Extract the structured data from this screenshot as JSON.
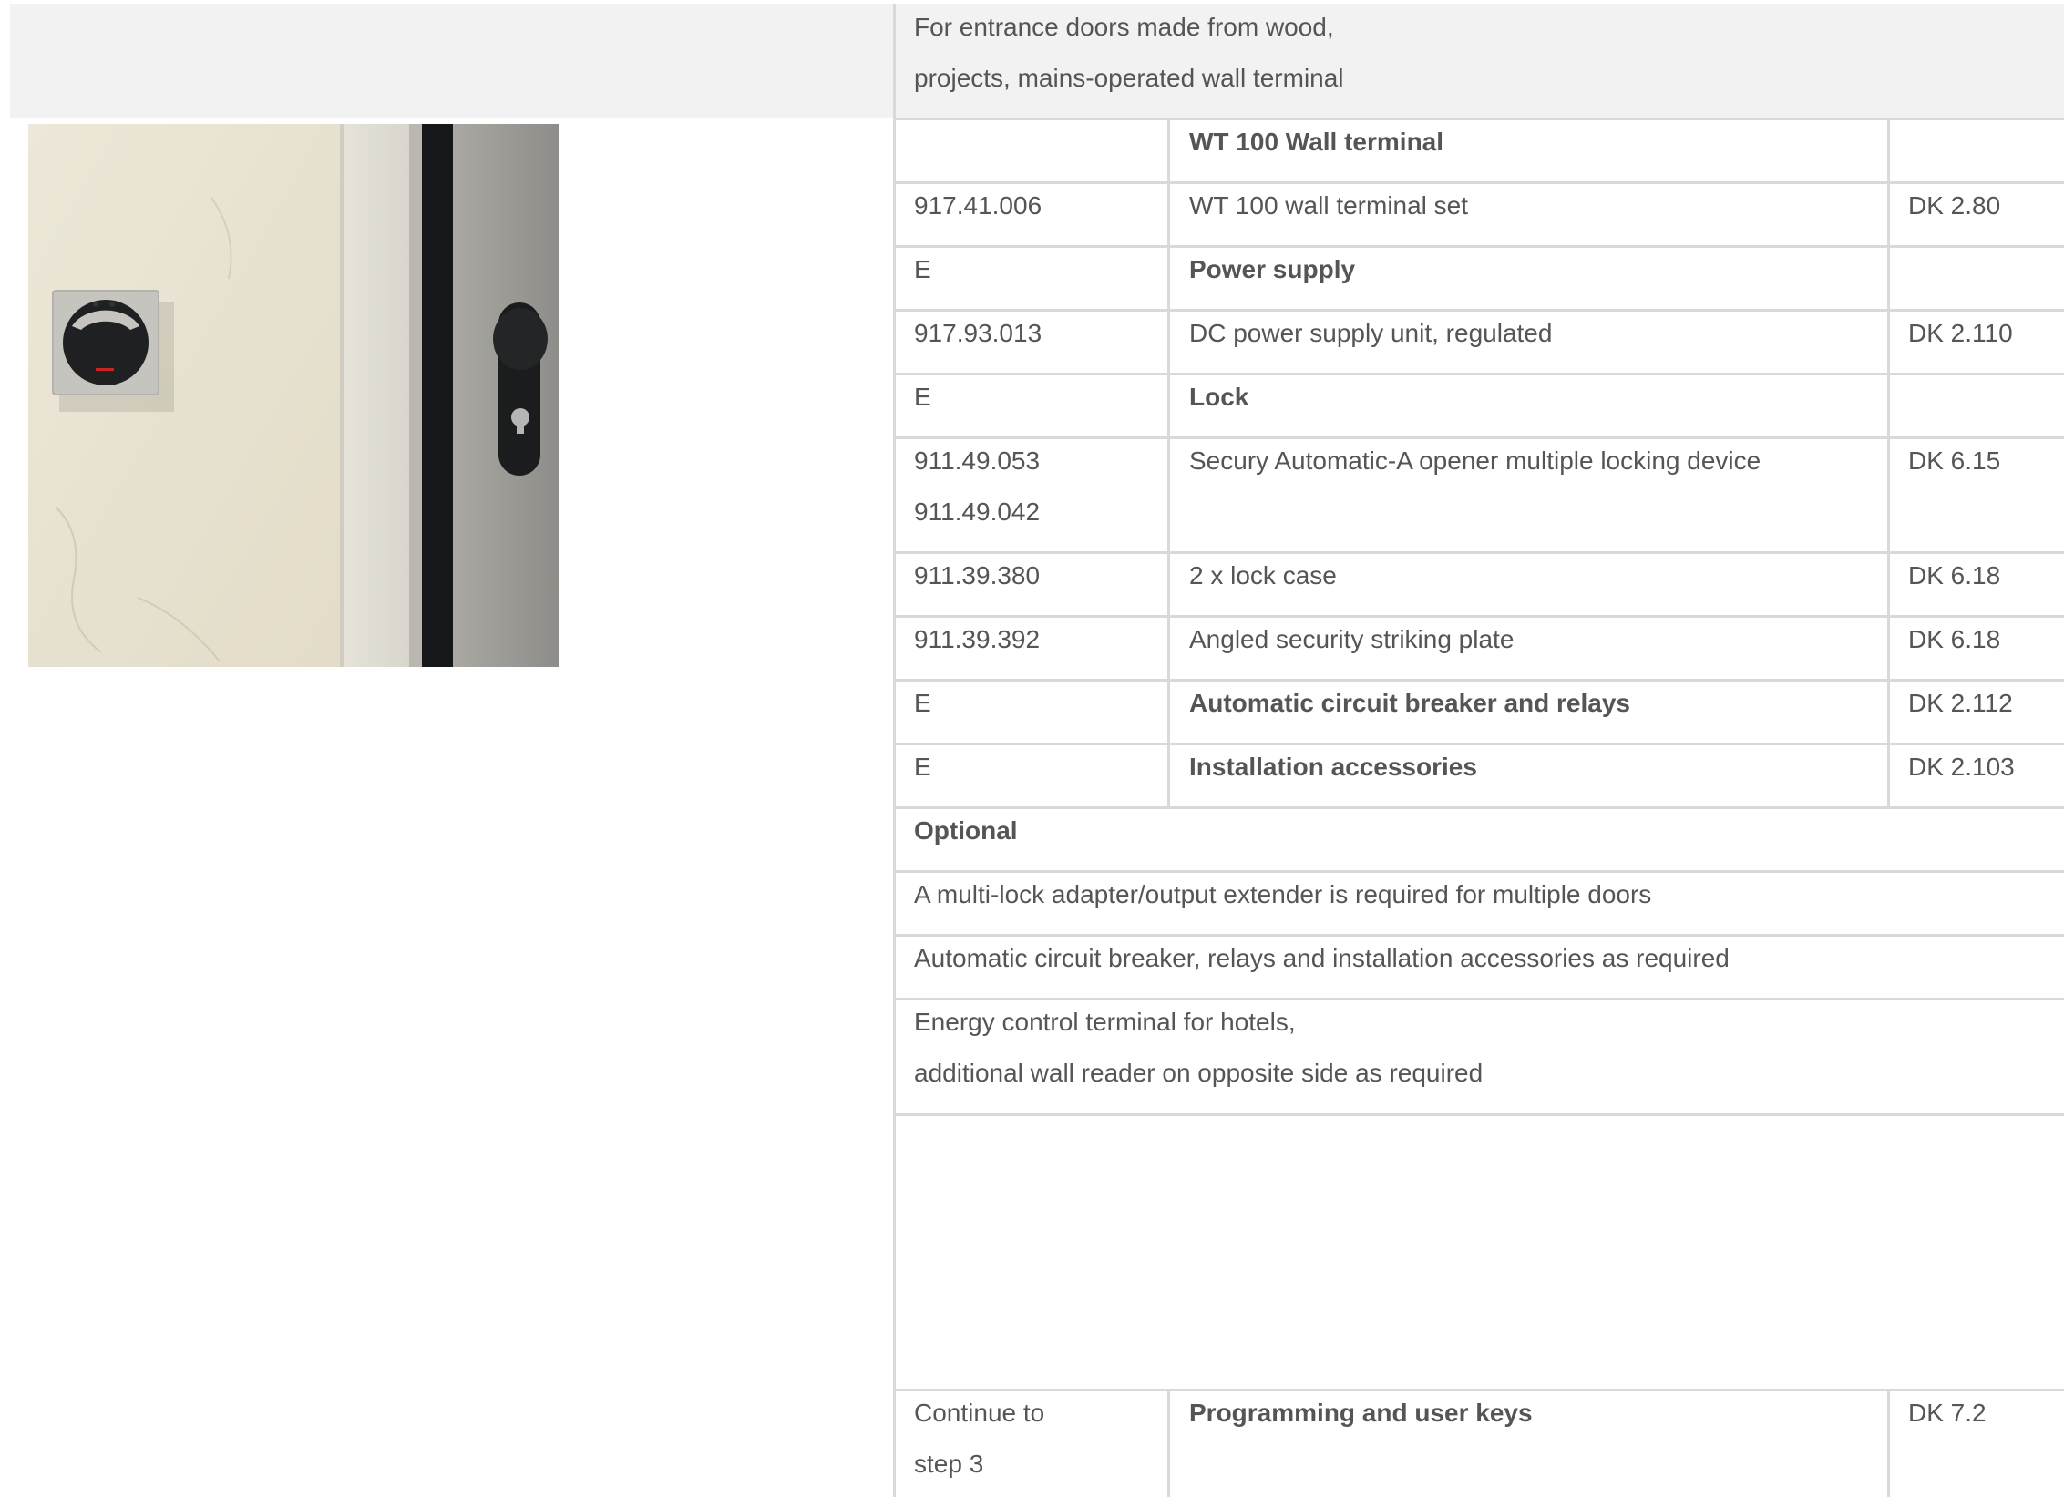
{
  "intro": {
    "line1": "For entrance doors made from wood,",
    "line2": "projects, mains-operated wall terminal"
  },
  "rows": [
    {
      "code": "",
      "desc": "WT 100 Wall terminal",
      "desc_bold": true,
      "ref": ""
    },
    {
      "code": "917.41.006",
      "desc": "WT 100 wall terminal set",
      "desc_bold": false,
      "ref": "DK 2.80"
    },
    {
      "code": "E",
      "desc": "Power supply",
      "desc_bold": true,
      "ref": ""
    },
    {
      "code": "917.93.013",
      "desc": "DC power supply unit, regulated",
      "desc_bold": false,
      "ref": "DK 2.110"
    },
    {
      "code": "E",
      "desc": "Lock",
      "desc_bold": true,
      "ref": ""
    },
    {
      "code": "911.49.053",
      "code2": "911.49.042",
      "desc": "Secury Automatic-A opener multiple locking device",
      "desc_bold": false,
      "ref": "DK 6.15"
    },
    {
      "code": "911.39.380",
      "desc": "2 x lock case",
      "desc_bold": false,
      "ref": "DK 6.18"
    },
    {
      "code": "911.39.392",
      "desc": "Angled security striking plate",
      "desc_bold": false,
      "ref": "DK 6.18"
    },
    {
      "code": "E",
      "desc": "Automatic circuit breaker and relays",
      "desc_bold": true,
      "ref": "DK 2.112"
    },
    {
      "code": "E",
      "desc": "Installation accessories",
      "desc_bold": true,
      "ref": "DK 2.103"
    }
  ],
  "optional": {
    "heading": "Optional",
    "items": [
      "A multi-lock adapter/output extender is required for multiple doors",
      "Automatic circuit breaker, relays and installation accessories as required"
    ],
    "energy_line1": "Energy control terminal for hotels,",
    "energy_line2": "additional wall reader on opposite side as required"
  },
  "continue": {
    "label_line1": "Continue to",
    "label_line2": "step 3",
    "desc": "Programming and user keys",
    "ref": "DK 7.2"
  },
  "colors": {
    "text": "#555555",
    "grid": "#d9d9d9",
    "band": "#f2f2f2"
  }
}
